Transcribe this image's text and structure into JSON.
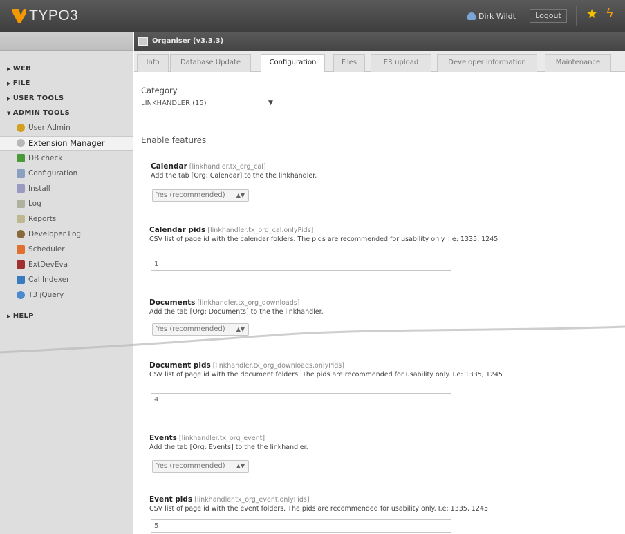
{
  "topbar": {
    "logo_text": "TYPO3",
    "user_name": "Dirk Wildt",
    "logout_label": "Logout",
    "icons": [
      "user-icon",
      "star-icon",
      "lightning-icon"
    ]
  },
  "sidebar": {
    "categories": [
      {
        "label": "WEB",
        "expanded": false
      },
      {
        "label": "FILE",
        "expanded": false
      },
      {
        "label": "USER TOOLS",
        "expanded": false
      },
      {
        "label": "ADMIN TOOLS",
        "expanded": true
      },
      {
        "label": "HELP",
        "expanded": false
      }
    ],
    "admin_modules": [
      {
        "label": "User Admin",
        "icon": "user-admin-icon",
        "color": "#d4a020",
        "active": false
      },
      {
        "label": "Extension Manager",
        "icon": "extension-icon",
        "color": "#b8b8b8",
        "active": true
      },
      {
        "label": "DB check",
        "icon": "db-check-icon",
        "color": "#4a9a3a",
        "active": false
      },
      {
        "label": "Configuration",
        "icon": "configuration-icon",
        "color": "#8aa0c0",
        "active": false
      },
      {
        "label": "Install",
        "icon": "install-icon",
        "color": "#9a9ac0",
        "active": false
      },
      {
        "label": "Log",
        "icon": "log-icon",
        "color": "#b0b0a0",
        "active": false
      },
      {
        "label": "Reports",
        "icon": "reports-icon",
        "color": "#c0b890",
        "active": false
      },
      {
        "label": "Developer Log",
        "icon": "developer-log-icon",
        "color": "#8a6a3a",
        "active": false
      },
      {
        "label": "Scheduler",
        "icon": "scheduler-icon",
        "color": "#e07030",
        "active": false
      },
      {
        "label": "ExtDevEva",
        "icon": "extdeveva-icon",
        "color": "#a03030",
        "active": false
      },
      {
        "label": "Cal Indexer",
        "icon": "cal-indexer-icon",
        "color": "#3a7ac0",
        "active": false
      },
      {
        "label": "T3 jQuery",
        "icon": "t3-jquery-icon",
        "color": "#4a8ad0",
        "active": false
      }
    ]
  },
  "docheader": {
    "title": "Organiser (v3.3.3)"
  },
  "tabs": [
    {
      "label": "Info",
      "active": false
    },
    {
      "label": "Database Update",
      "active": false
    },
    {
      "label": "Configuration",
      "active": true
    },
    {
      "label": "Files",
      "active": false
    },
    {
      "label": "ER upload",
      "active": false
    },
    {
      "label": "Developer Information",
      "active": false
    },
    {
      "label": "Maintenance",
      "active": false
    }
  ],
  "config": {
    "category_label": "Category",
    "category_value": "LINKHANDLER (15)",
    "section_title": "Enable features",
    "fields": [
      {
        "title": "Calendar",
        "key": "[linkhandler.tx_org_cal]",
        "description": "Add the tab [Org: Calendar] to the the linkhandler.",
        "type": "select",
        "value": "Yes (recommended)"
      },
      {
        "title": "Calendar pids",
        "key": "[linkhandler.tx_org_cal.onlyPids]",
        "description": "CSV list of page id with the calendar folders. The pids are recommended for usability only. I.e: 1335, 1245",
        "type": "input",
        "value": "1"
      },
      {
        "title": "Documents",
        "key": "[linkhandler.tx_org_downloads]",
        "description": "Add the tab [Org: Documents] to the the linkhandler.",
        "type": "select",
        "value": "Yes (recommended)"
      },
      {
        "title": "Document pids",
        "key": "[linkhandler.tx_org_downloads.onlyPids]",
        "description": "CSV list of page id with the document folders. The pids are recommended for usability only. I.e: 1335, 1245",
        "type": "input",
        "value": "4"
      },
      {
        "title": "Events",
        "key": "[linkhandler.tx_org_event]",
        "description": "Add the tab [Org: Events] to the the linkhandler.",
        "type": "select",
        "value": "Yes (recommended)"
      },
      {
        "title": "Event pids",
        "key": "[linkhandler.tx_org_event.onlyPids]",
        "description": "CSV list of page id with the event folders. The pids are recommended for usability only. I.e: 1335, 1245",
        "type": "input",
        "value": "5"
      }
    ]
  }
}
